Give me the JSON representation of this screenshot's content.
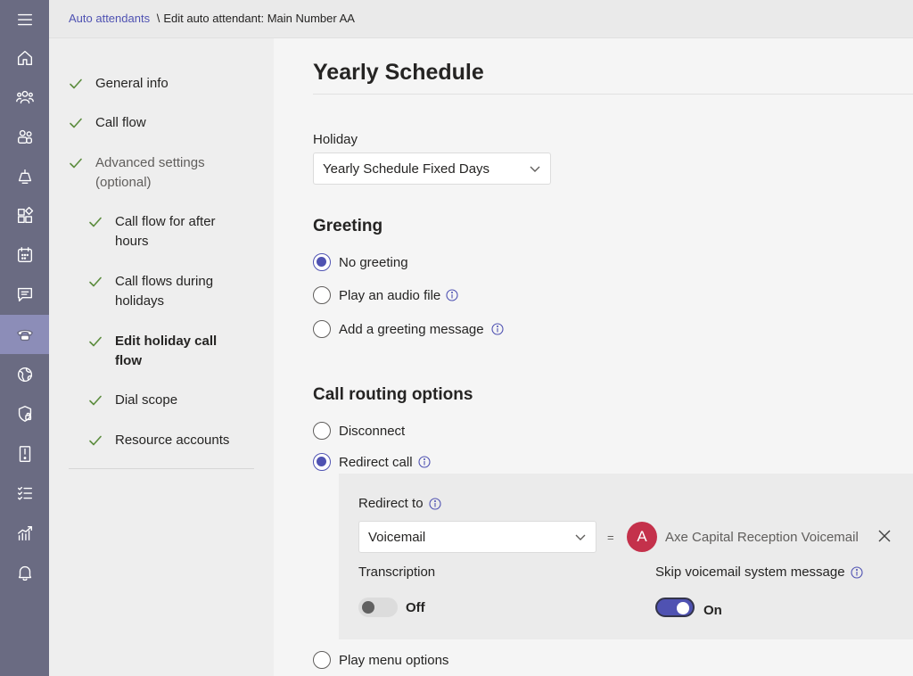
{
  "breadcrumb": {
    "parent": "Auto attendants",
    "separator": "\\",
    "current": "Edit auto attendant: Main Number AA"
  },
  "rail": {
    "items": [
      {
        "icon": "hamburger-menu-icon"
      },
      {
        "icon": "home-icon"
      },
      {
        "icon": "users-icon"
      },
      {
        "icon": "teams-icon"
      },
      {
        "icon": "meetings-icon"
      },
      {
        "icon": "apps-icon"
      },
      {
        "icon": "calendar-icon"
      },
      {
        "icon": "messaging-icon"
      },
      {
        "icon": "voice-icon",
        "active": true
      },
      {
        "icon": "locations-icon"
      },
      {
        "icon": "security-icon"
      },
      {
        "icon": "devices-icon"
      },
      {
        "icon": "policy-list-icon"
      },
      {
        "icon": "analytics-icon"
      },
      {
        "icon": "notifications-icon"
      }
    ]
  },
  "steps": [
    {
      "label": "General info"
    },
    {
      "label": "Call flow"
    },
    {
      "label_line1": "Advanced settings",
      "label_line2": "(optional)"
    },
    {
      "label_line1": "Call flow for after",
      "label_line2": "hours"
    },
    {
      "label_line1": "Call flows during",
      "label_line2": "holidays"
    },
    {
      "label_line1": "Edit holiday call",
      "label_line2": "flow"
    },
    {
      "label": "Dial scope"
    },
    {
      "label": "Resource accounts"
    }
  ],
  "main": {
    "title": "Yearly Schedule",
    "holiday": {
      "label": "Holiday",
      "value": "Yearly Schedule Fixed Days"
    },
    "greeting": {
      "title": "Greeting",
      "options": [
        "No greeting",
        "Play an audio file",
        "Add a greeting message"
      ],
      "selected": "No greeting"
    },
    "routing": {
      "title": "Call routing options",
      "options": [
        "Disconnect",
        "Redirect call",
        "Play menu options"
      ],
      "selected": "Redirect call"
    },
    "redirect": {
      "label": "Redirect to",
      "value": "Voicemail",
      "equals": "=",
      "target_initial": "A",
      "target_name": "Axe Capital Reception Voicemail",
      "transcription_label": "Transcription",
      "transcription_state": "Off",
      "skip_label": "Skip voicemail system message",
      "skip_state": "On"
    }
  },
  "colors": {
    "rail_bg": "#6a6b82",
    "accent": "#4f52b2",
    "check_green": "#5b8c3d",
    "avatar_red": "#c4314b"
  }
}
